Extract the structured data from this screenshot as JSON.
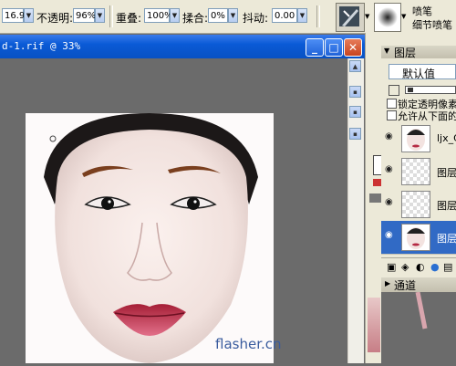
{
  "toolbar": {
    "size_value": "16.9",
    "opacity_label": "不透明:",
    "opacity_value": "96%",
    "overlap_label": "重叠:",
    "overlap_value": "100%",
    "blend_label": "揉合:",
    "blend_value": "0%",
    "jitter_label": "抖动:",
    "jitter_value": "0.00"
  },
  "brush": {
    "category": "喷笔",
    "variant": "细节喷笔"
  },
  "document": {
    "title": "d-1.rif @ 33%",
    "watermark": "flasher.cn"
  },
  "layers_panel": {
    "title": "图层",
    "composite_method": "默认值",
    "lock_transparency": "锁定透明像素",
    "allow_below": "允许从下面的",
    "layers": [
      {
        "name": "ljx_C"
      },
      {
        "name": "图层"
      },
      {
        "name": "图层"
      },
      {
        "name": "图层"
      }
    ],
    "channels_title": "通道"
  },
  "colors": {
    "titlebar": "#0a5ad6",
    "selected_layer": "#316ac5",
    "panel_bg": "#ece9d8"
  }
}
